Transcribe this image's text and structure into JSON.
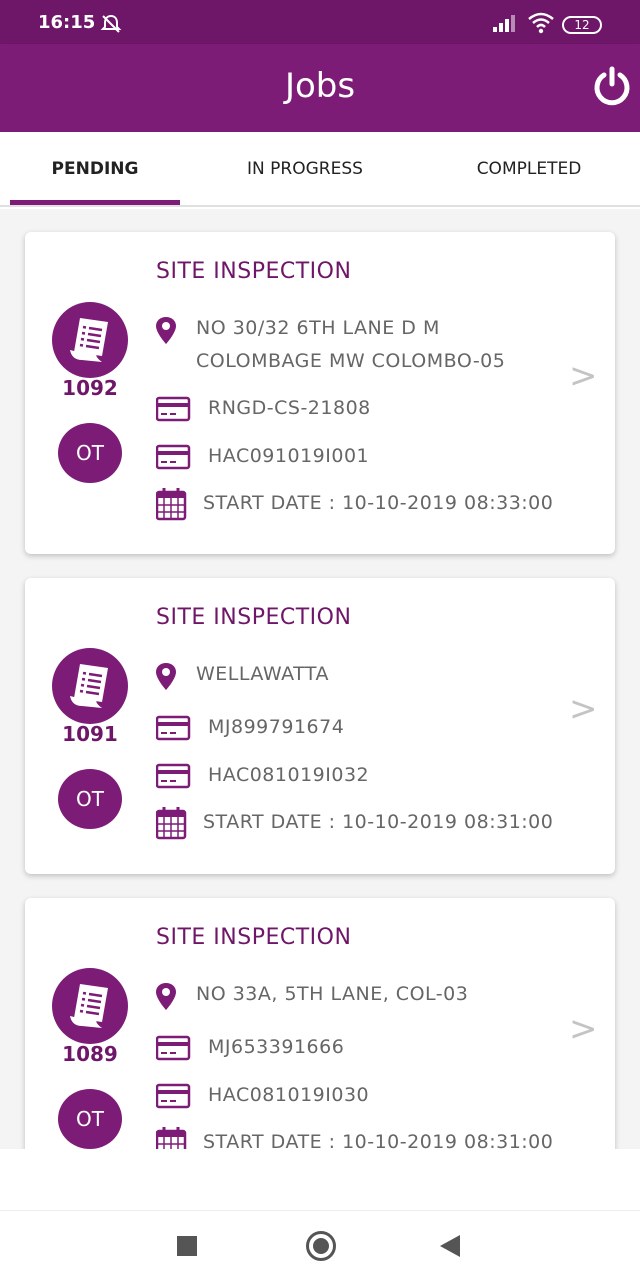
{
  "status_bar": {
    "time": "16:15",
    "battery": "12",
    "icons": [
      "mute-icon",
      "signal-icon",
      "wifi-icon",
      "battery-icon"
    ]
  },
  "app_bar": {
    "title": "Jobs",
    "power_icon": "power-icon"
  },
  "tabs": [
    {
      "label": "PENDING",
      "active": true
    },
    {
      "label": "IN PROGRESS",
      "active": false
    },
    {
      "label": "COMPLETED",
      "active": false
    }
  ],
  "jobs": [
    {
      "job_type": "SITE INSPECTION",
      "job_no": "1092",
      "badge": "OT",
      "address": [
        "NO 30/32 6TH LANE D M",
        "COLOMBAGE MW COLOMBO-05"
      ],
      "ref1": "RNGD-CS-21808",
      "ref2": "HAC091019I001",
      "start_date": "START DATE : 10-10-2019 08:33:00"
    },
    {
      "job_type": "SITE INSPECTION",
      "job_no": "1091",
      "badge": "OT",
      "address": [
        "WELLAWATTA"
      ],
      "ref1": "MJ899791674",
      "ref2": "HAC081019I032",
      "start_date": "START DATE : 10-10-2019 08:31:00"
    },
    {
      "job_type": "SITE INSPECTION",
      "job_no": "1089",
      "badge": "OT",
      "address": [
        "NO 33A, 5TH LANE, COL-03"
      ],
      "ref1": "MJ653391666",
      "ref2": "HAC081019I030",
      "start_date": "START DATE : 10-10-2019 08:31:00"
    }
  ],
  "colors": {
    "primary": "#7d1c77",
    "primary_dark": "#6e1668",
    "text_secondary": "#666666"
  },
  "nav_bar": {
    "icons": [
      "recents-icon",
      "home-icon",
      "back-icon"
    ]
  }
}
